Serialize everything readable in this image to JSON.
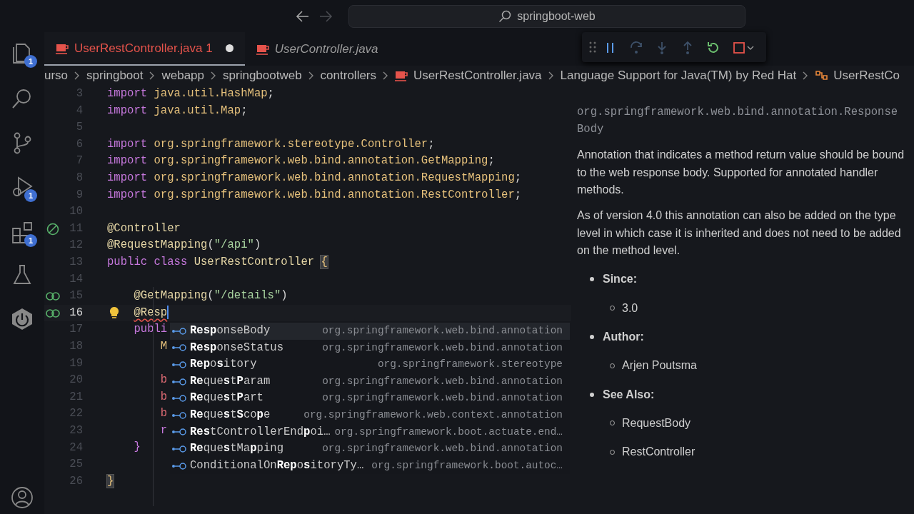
{
  "title_bar": {
    "nav": [
      {
        "kind": "back",
        "disabled": false
      },
      {
        "kind": "forward",
        "disabled": true
      }
    ],
    "search": "springboot-web"
  },
  "activity_bar": [
    {
      "kind": "explorer",
      "badge": "1"
    },
    {
      "kind": "search"
    },
    {
      "kind": "scm"
    },
    {
      "kind": "debug",
      "badge": "1"
    },
    {
      "kind": "extensions",
      "badge": "1"
    },
    {
      "kind": "testing"
    },
    {
      "kind": "spring"
    },
    {
      "kind": "account"
    }
  ],
  "tabs": [
    {
      "label": "UserRestController.java",
      "badge": "1",
      "has_error": true,
      "modified": true,
      "preview": false,
      "selected": true
    },
    {
      "label": "UserController.java",
      "has_error": false,
      "modified": false,
      "preview": true,
      "selected": false
    }
  ],
  "debug_toolbar": [
    {
      "kind": "pause",
      "disabled": false
    },
    {
      "kind": "step_over",
      "disabled": true
    },
    {
      "kind": "step_into",
      "disabled": true
    },
    {
      "kind": "step_out",
      "disabled": true
    },
    {
      "kind": "restart",
      "disabled": false
    },
    {
      "kind": "stop",
      "disabled": false
    }
  ],
  "breadcrumbs": [
    {
      "label": "urso"
    },
    {
      "label": "springboot"
    },
    {
      "label": "webapp"
    },
    {
      "label": "springbootweb"
    },
    {
      "label": "controllers"
    },
    {
      "label": "UserRestController.java",
      "kind": "file"
    },
    {
      "label": "Language Support for Java(TM) by Red Hat"
    },
    {
      "label": "UserRestCo",
      "kind": "symbol"
    }
  ],
  "editor": {
    "lines": [
      {
        "number": "3",
        "tokens": [
          {
            "kind": "kw",
            "text": "import "
          },
          {
            "kind": "type",
            "text": "java.util.HashMap"
          },
          {
            "kind": "plain",
            "text": ";"
          }
        ]
      },
      {
        "number": "4",
        "tokens": [
          {
            "kind": "kw",
            "text": "import "
          },
          {
            "kind": "type",
            "text": "java.util.Map"
          },
          {
            "kind": "plain",
            "text": ";"
          }
        ]
      },
      {
        "number": "5"
      },
      {
        "number": "6",
        "tokens": [
          {
            "kind": "kw",
            "text": "import "
          },
          {
            "kind": "type",
            "text": "org.springframework.stereotype.Controller"
          },
          {
            "kind": "plain",
            "text": ";"
          }
        ]
      },
      {
        "number": "7",
        "tokens": [
          {
            "kind": "kw",
            "text": "import "
          },
          {
            "kind": "type",
            "text": "org.springframework.web.bind.annotation.GetMapping"
          },
          {
            "kind": "plain",
            "text": ";"
          }
        ]
      },
      {
        "number": "8",
        "tokens": [
          {
            "kind": "kw",
            "text": "import "
          },
          {
            "kind": "type",
            "text": "org.springframework.web.bind.annotation.RequestMapping"
          },
          {
            "kind": "plain",
            "text": ";"
          }
        ]
      },
      {
        "number": "9",
        "tokens": [
          {
            "kind": "kw",
            "text": "import "
          },
          {
            "kind": "type",
            "text": "org.springframework.web.bind.annotation.RestController"
          },
          {
            "kind": "plain",
            "text": ";"
          }
        ]
      },
      {
        "number": "10"
      },
      {
        "number": "11",
        "decoration": {
          "kind": "bean"
        },
        "tokens": [
          {
            "kind": "anno",
            "text": "@Controller"
          }
        ]
      },
      {
        "number": "12",
        "tokens": [
          {
            "kind": "anno",
            "text": "@RequestMapping"
          },
          {
            "kind": "plain",
            "text": "("
          },
          {
            "kind": "str",
            "text": "\"/api\""
          },
          {
            "kind": "plain",
            "text": ")"
          }
        ]
      },
      {
        "number": "13",
        "tokens": [
          {
            "kind": "kw",
            "text": "public class "
          },
          {
            "kind": "anno",
            "text": "UserRestController "
          },
          {
            "kind": "bracket_match",
            "text": "{"
          }
        ]
      },
      {
        "number": "14"
      },
      {
        "number": "15",
        "decoration": {
          "kind": "link"
        },
        "tokens": [
          {
            "kind": "anno",
            "text": "    @GetMapping"
          },
          {
            "kind": "plain",
            "text": "("
          },
          {
            "kind": "str",
            "text": "\"/details\""
          },
          {
            "kind": "plain",
            "text": ")"
          }
        ]
      },
      {
        "number": "16",
        "decoration": {
          "kind": "link"
        },
        "current": true,
        "lightbulb": true,
        "tokens": [
          {
            "kind": "error",
            "text": "    @Resp"
          }
        ]
      },
      {
        "number": "17",
        "tokens": [
          {
            "kind": "kw",
            "text": "    publi"
          }
        ]
      },
      {
        "number": "18",
        "tokens": [
          {
            "kind": "type",
            "text": "        M"
          }
        ]
      },
      {
        "number": "19"
      },
      {
        "number": "20",
        "tokens": [
          {
            "kind": "var",
            "text": "        b"
          }
        ]
      },
      {
        "number": "21",
        "tokens": [
          {
            "kind": "var",
            "text": "        b"
          }
        ]
      },
      {
        "number": "22",
        "tokens": [
          {
            "kind": "var",
            "text": "        b"
          }
        ]
      },
      {
        "number": "23",
        "tokens": [
          {
            "kind": "kw",
            "text": "        r"
          }
        ]
      },
      {
        "number": "24",
        "tokens": [
          {
            "kind": "bracket2",
            "text": "    }"
          }
        ]
      },
      {
        "number": "25"
      },
      {
        "number": "26",
        "tokens": [
          {
            "kind": "bracket_match",
            "text": "}"
          }
        ]
      }
    ]
  },
  "suggestions": [
    {
      "label": "**Resp**onseBody",
      "detail": "org.springframework.web.bind.annotation",
      "selected": true
    },
    {
      "label": "**Resp**onseStatus",
      "detail": "org.springframework.web.bind.annotation",
      "selected": false
    },
    {
      "label": "**Rep**o**s**itory",
      "detail": "org.springframework.stereotype",
      "selected": false
    },
    {
      "label": "**Re**que**s**t**P**aram",
      "detail": "org.springframework.web.bind.annotation",
      "selected": false
    },
    {
      "label": "**Re**que**s**t**P**art",
      "detail": "org.springframework.web.bind.annotation",
      "selected": false
    },
    {
      "label": "**Re**que**s**t**S**co**p**e",
      "detail": "org.springframework.web.context.annotation",
      "selected": false
    },
    {
      "label": "**Res**tControllerEnd**p**oi…",
      "detail": "org.springframework.boot.actuate.end…",
      "selected": false
    },
    {
      "label": "**Re**que**s**tMa**p**ping",
      "detail": "org.springframework.web.bind.annotation",
      "selected": false
    },
    {
      "label": "ConditionalOn**Rep**o**s**itoryTy…",
      "detail": "org.springframework.boot.autoc…",
      "selected": false
    }
  ],
  "hover": {
    "signature": "org.springframework.web.bind.annotation.ResponseBody",
    "paragraphs": [
      "Annotation that indicates a method return value should be bound to the web response body. Supported for annotated handler methods.",
      "As of version 4.0 this annotation can also be added on the type level in which case it is inherited and does not need to be added on the method level."
    ],
    "sections": [
      {
        "heading": "Since:",
        "items": [
          "3.0"
        ]
      },
      {
        "heading": "Author:",
        "items": [
          "Arjen Poutsma"
        ]
      },
      {
        "heading": "See Also:",
        "items": [
          "RequestBody",
          "RestController"
        ]
      }
    ]
  }
}
